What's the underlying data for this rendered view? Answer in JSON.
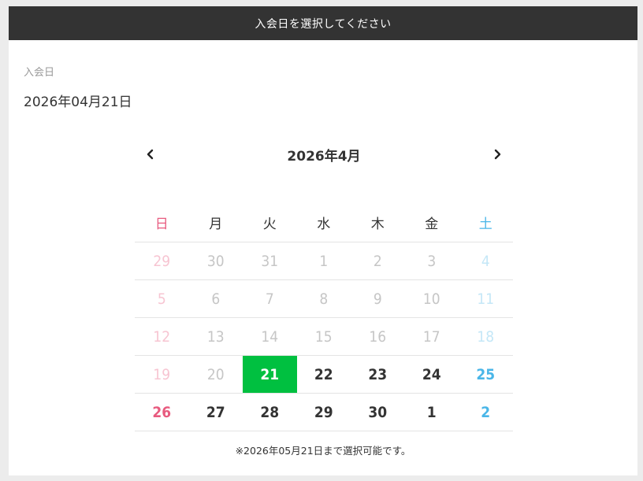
{
  "header": {
    "title": "入会日を選択してください"
  },
  "field": {
    "label": "入会日",
    "value": "2026年04月21日"
  },
  "calendar": {
    "month_title": "2026年4月",
    "weekdays": [
      "日",
      "月",
      "火",
      "水",
      "木",
      "金",
      "土"
    ],
    "weeks": [
      [
        "29",
        "30",
        "31",
        "1",
        "2",
        "3",
        "4"
      ],
      [
        "5",
        "6",
        "7",
        "8",
        "9",
        "10",
        "11"
      ],
      [
        "12",
        "13",
        "14",
        "15",
        "16",
        "17",
        "18"
      ],
      [
        "19",
        "20",
        "21",
        "22",
        "23",
        "24",
        "25"
      ],
      [
        "26",
        "27",
        "28",
        "29",
        "30",
        "1",
        "2"
      ]
    ],
    "selected": "21",
    "colors": {
      "selected_bg": "#00c040",
      "sunday": "#e85b7f",
      "saturday": "#4ab6e8"
    }
  },
  "note": "※2026年05月21日まで選択可能です。"
}
